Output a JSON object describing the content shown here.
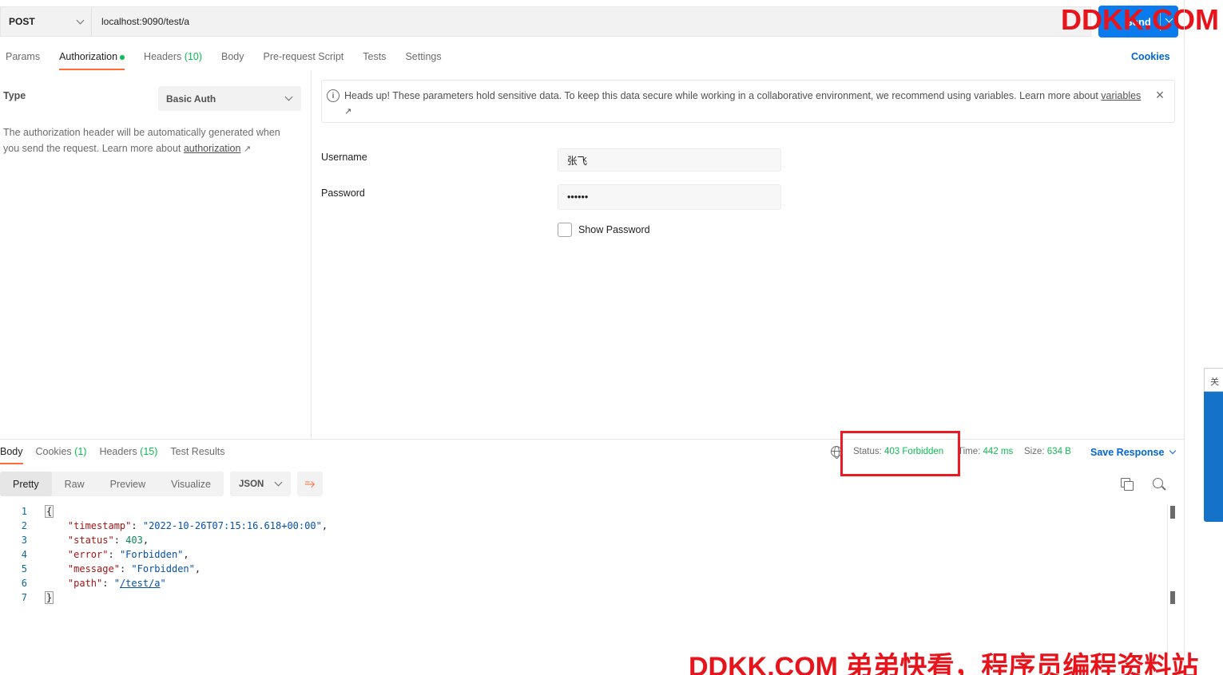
{
  "request": {
    "method": "POST",
    "url": "localhost:9090/test/a",
    "send_label": "Send"
  },
  "watermark": {
    "top": "DDKK.COM",
    "bottom": "DDKK.COM 弟弟快看，程序员编程资料站"
  },
  "tabs": {
    "params": "Params",
    "authorization": "Authorization",
    "headers": "Headers",
    "headers_count": "(10)",
    "body": "Body",
    "pre_request": "Pre-request Script",
    "tests": "Tests",
    "settings": "Settings",
    "cookies": "Cookies"
  },
  "auth": {
    "type_label": "Type",
    "type_value": "Basic Auth",
    "desc_text": "The authorization header will be automatically generated when you send the request. Learn more about ",
    "desc_link": "authorization",
    "alert_text": "Heads up! These parameters hold sensitive data. To keep this data secure while working in a collaborative environment, we recommend using variables. Learn more about ",
    "alert_link": "variables",
    "username_label": "Username",
    "username_value": "张飞",
    "password_label": "Password",
    "password_value": "••••••",
    "show_password": "Show Password"
  },
  "response": {
    "tabs": {
      "body": "Body",
      "cookies": "Cookies",
      "cookies_count": "(1)",
      "headers": "Headers",
      "headers_count": "(15)",
      "test_results": "Test Results"
    },
    "status_label": "Status:",
    "status_value": "403 Forbidden",
    "time_label": "Time:",
    "time_value": "442 ms",
    "size_label": "Size:",
    "size_value": "634 B",
    "save_response": "Save Response",
    "views": {
      "pretty": "Pretty",
      "raw": "Raw",
      "preview": "Preview",
      "visualize": "Visualize"
    },
    "format": "JSON",
    "code": {
      "ln1": "1",
      "ln2": "2",
      "ln3": "3",
      "ln4": "4",
      "ln5": "5",
      "ln6": "6",
      "ln7": "7",
      "open": "{",
      "close": "}",
      "timestamp_key": "\"timestamp\"",
      "timestamp_val": "\"2022-10-26T07:15:16.618+00:00\"",
      "status_key": "\"status\"",
      "status_val": "403",
      "error_key": "\"error\"",
      "error_val": "\"Forbidden\"",
      "message_key": "\"message\"",
      "message_val": "\"Forbidden\"",
      "path_key": "\"path\"",
      "path_val": "/test/a"
    }
  },
  "side_widget": {
    "label": "关"
  },
  "colors": {
    "accent": "#ff6c37",
    "primary": "#097bed",
    "link": "#0265d2",
    "success": "#0cbb52",
    "highlight": "#ea1b22"
  }
}
